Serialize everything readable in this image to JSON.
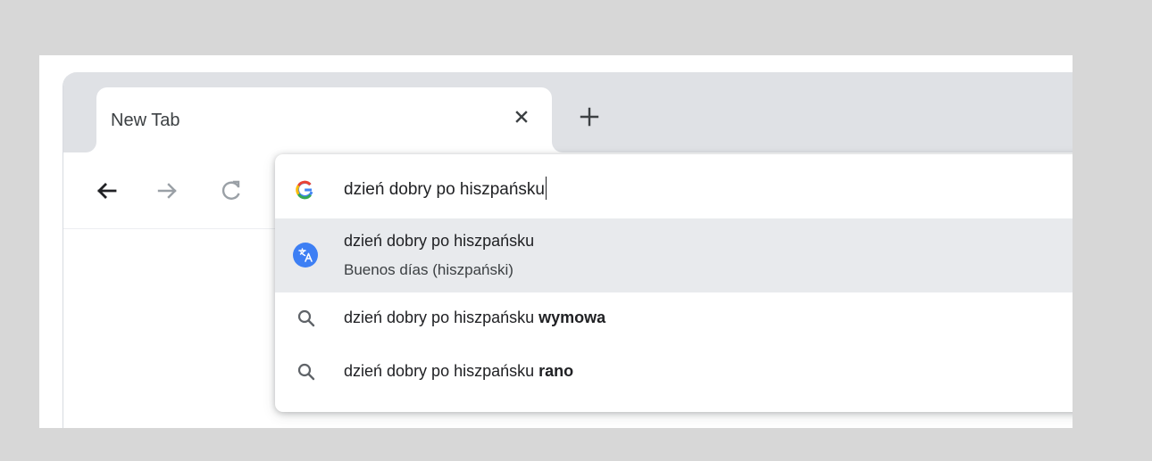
{
  "tab": {
    "title": "New Tab",
    "close_icon": "close-icon"
  },
  "toolbar": {
    "back_icon": "arrow-left-icon",
    "forward_icon": "arrow-right-icon",
    "reload_icon": "reload-icon",
    "new_tab_icon": "plus-icon"
  },
  "omnibox": {
    "value": "dzień dobry po hiszpańsku",
    "search_provider_icon": "google-icon"
  },
  "suggestions": [
    {
      "type": "translation",
      "icon": "translate-icon",
      "primary": "dzień dobry po hiszpańsku",
      "secondary": "Buenos días (hiszpański)",
      "selected": true
    },
    {
      "type": "search",
      "icon": "search-icon",
      "prefix": "dzień dobry po hiszpańsku",
      "suffix": "wymowa",
      "selected": false
    },
    {
      "type": "search",
      "icon": "search-icon",
      "prefix": "dzień dobry po hiszpańsku",
      "suffix": "rano",
      "selected": false
    }
  ],
  "colors": {
    "page_background": "#d7d7d7",
    "tab_strip": "#dfe1e5",
    "selected_row": "#e8eaed",
    "translate_badge": "#3d7ff4",
    "text_primary": "#202124",
    "icon_gray": "#5f6368"
  }
}
